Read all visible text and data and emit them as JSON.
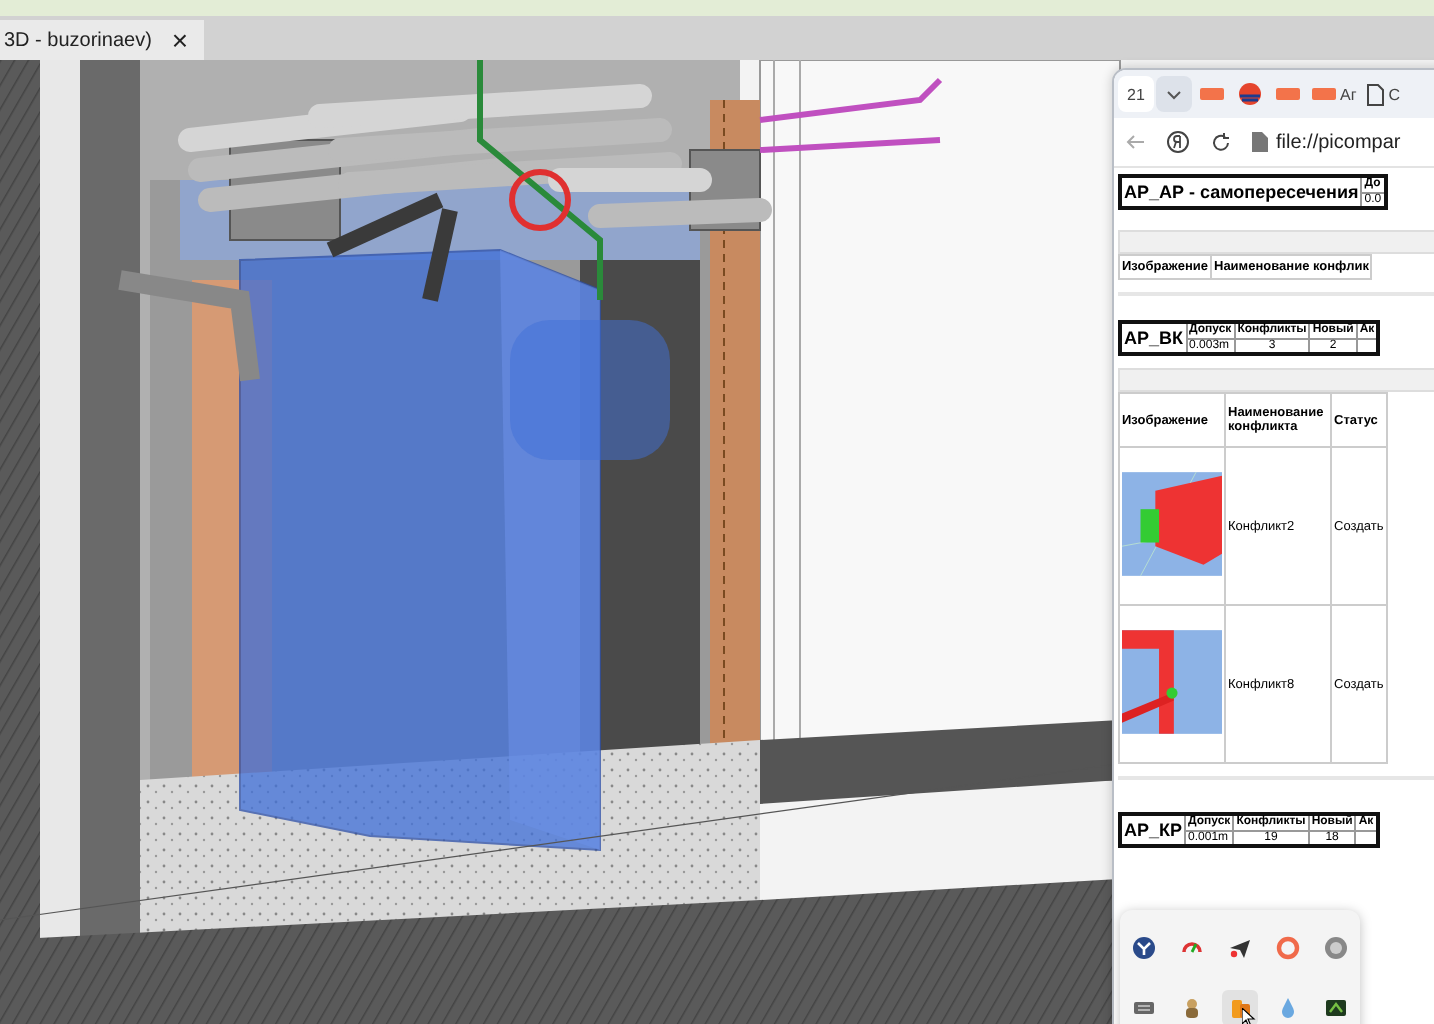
{
  "app_tab": {
    "title": "3D - buzorinaev)",
    "close": "×"
  },
  "browser": {
    "tabs": [
      {
        "kind": "count",
        "label": "21",
        "selected": true
      },
      {
        "kind": "favicon",
        "selected": false
      },
      {
        "kind": "logo",
        "selected": false
      },
      {
        "kind": "favicon",
        "selected": false
      },
      {
        "kind": "favicon",
        "label": "Аг",
        "selected": false
      },
      {
        "kind": "page",
        "label": "С",
        "selected": false
      }
    ],
    "address": "file://picompar",
    "reports": [
      {
        "title": "АР_АР - самопересечения",
        "summary_headers": [
          "До"
        ],
        "summary_values": [
          "0.0"
        ],
        "columns": [
          "Изображение",
          "Наименование конфлик"
        ]
      },
      {
        "title": "АР_ВК",
        "summary_headers": [
          "Допуск",
          "Конфликты",
          "Новый",
          "Ак"
        ],
        "summary_values": [
          "0.003m",
          "3",
          "2"
        ],
        "columns": [
          "Изображение",
          "Наименование конфликта",
          "Статус"
        ],
        "rows": [
          {
            "name": "Конфликт2",
            "status": "Создать",
            "kind": "box"
          },
          {
            "name": "Конфликт8",
            "status": "Создать",
            "kind": "wall"
          }
        ]
      },
      {
        "title": "АР_КР",
        "summary_headers": [
          "Допуск",
          "Конфликты",
          "Новый",
          "Ак"
        ],
        "summary_values": [
          "0.001m",
          "19",
          "18"
        ]
      }
    ]
  },
  "tray": [
    {
      "kind": "shield",
      "selected": false
    },
    {
      "kind": "gauge",
      "selected": false
    },
    {
      "kind": "plane",
      "selected": false
    },
    {
      "kind": "ring",
      "selected": false
    },
    {
      "kind": "disc",
      "selected": false
    },
    {
      "kind": "keyboard",
      "selected": false
    },
    {
      "kind": "figure",
      "selected": false
    },
    {
      "kind": "folder",
      "selected": true
    },
    {
      "kind": "drop",
      "selected": false
    },
    {
      "kind": "chip",
      "selected": false
    }
  ]
}
